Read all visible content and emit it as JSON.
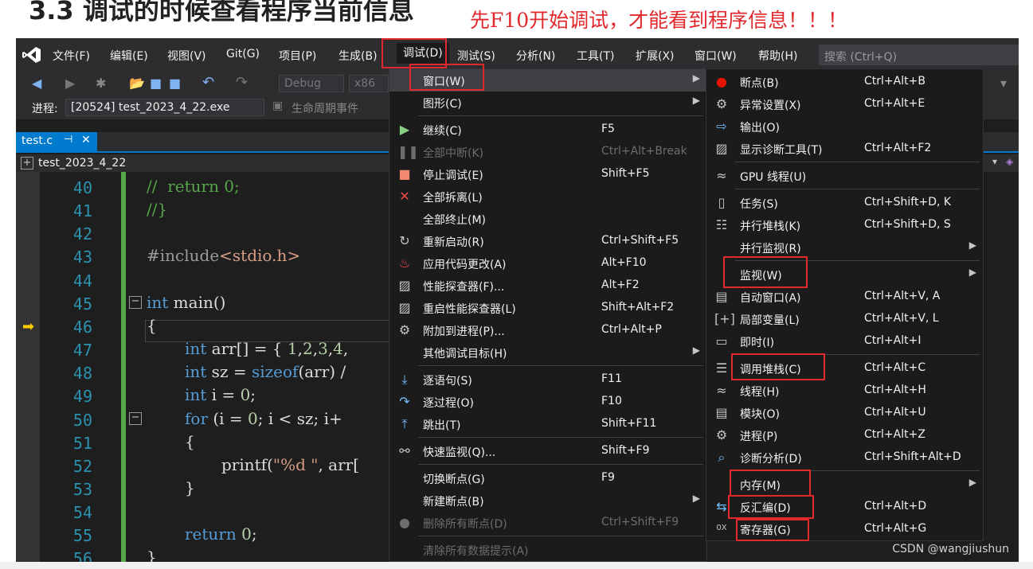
{
  "page": {
    "heading": "3.3 调试的时候查看程序当前信息",
    "annotation": "先F10开始调试，才能看到程序信息！！！",
    "watermark": "CSDN @wangjiushun"
  },
  "menubar": {
    "items": [
      "文件(F)",
      "编辑(E)",
      "视图(V)",
      "Git(G)",
      "项目(P)",
      "生成(B)",
      "调试(D)",
      "测试(S)",
      "分析(N)",
      "工具(T)",
      "扩展(X)",
      "窗口(W)",
      "帮助(H)"
    ],
    "search_placeholder": "搜索 (Ctrl+Q)"
  },
  "toolbar": {
    "config": "Debug",
    "platform": "x86",
    "process_label": "进程:",
    "process_value": "[20524] test_2023_4_22.exe",
    "lifecycle": "生命周期事件"
  },
  "tab": {
    "label": "test.c"
  },
  "nav": {
    "project": "test_2023_4_22"
  },
  "editor": {
    "line_numbers": [
      "40",
      "41",
      "42",
      "43",
      "44",
      "45",
      "46",
      "47",
      "48",
      "49",
      "50",
      "51",
      "52",
      "53",
      "54",
      "55",
      "56"
    ]
  },
  "debug_menu": {
    "items": [
      {
        "label": "窗口(W)",
        "shortcut": "",
        "sub": true
      },
      {
        "label": "图形(C)",
        "shortcut": "",
        "sub": true
      },
      {
        "label": "继续(C)",
        "shortcut": "F5"
      },
      {
        "label": "全部中断(K)",
        "shortcut": "Ctrl+Alt+Break"
      },
      {
        "label": "停止调试(E)",
        "shortcut": "Shift+F5"
      },
      {
        "label": "全部拆离(L)",
        "shortcut": ""
      },
      {
        "label": "全部终止(M)",
        "shortcut": ""
      },
      {
        "label": "重新启动(R)",
        "shortcut": "Ctrl+Shift+F5"
      },
      {
        "label": "应用代码更改(A)",
        "shortcut": "Alt+F10"
      },
      {
        "label": "性能探查器(F)...",
        "shortcut": "Alt+F2"
      },
      {
        "label": "重启性能探查器(L)",
        "shortcut": "Shift+Alt+F2"
      },
      {
        "label": "附加到进程(P)...",
        "shortcut": "Ctrl+Alt+P"
      },
      {
        "label": "其他调试目标(H)",
        "shortcut": "",
        "sub": true
      },
      {
        "label": "逐语句(S)",
        "shortcut": "F11"
      },
      {
        "label": "逐过程(O)",
        "shortcut": "F10"
      },
      {
        "label": "跳出(T)",
        "shortcut": "Shift+F11"
      },
      {
        "label": "快速监视(Q)...",
        "shortcut": "Shift+F9"
      },
      {
        "label": "切换断点(G)",
        "shortcut": "F9"
      },
      {
        "label": "新建断点(B)",
        "shortcut": "",
        "sub": true
      },
      {
        "label": "删除所有断点(D)",
        "shortcut": "Ctrl+Shift+F9"
      },
      {
        "label": "清除所有数据提示(A)",
        "shortcut": ""
      }
    ]
  },
  "window_menu": {
    "items": [
      {
        "label": "断点(B)",
        "shortcut": "Ctrl+Alt+B"
      },
      {
        "label": "异常设置(X)",
        "shortcut": "Ctrl+Alt+E"
      },
      {
        "label": "输出(O)",
        "shortcut": ""
      },
      {
        "label": "显示诊断工具(T)",
        "shortcut": "Ctrl+Alt+F2"
      },
      {
        "label": "GPU 线程(U)",
        "shortcut": ""
      },
      {
        "label": "任务(S)",
        "shortcut": "Ctrl+Shift+D, K"
      },
      {
        "label": "并行堆栈(K)",
        "shortcut": "Ctrl+Shift+D, S"
      },
      {
        "label": "并行监视(R)",
        "shortcut": "",
        "sub": true
      },
      {
        "label": "监视(W)",
        "shortcut": "",
        "sub": true
      },
      {
        "label": "自动窗口(A)",
        "shortcut": "Ctrl+Alt+V, A"
      },
      {
        "label": "局部变量(L)",
        "shortcut": "Ctrl+Alt+V, L"
      },
      {
        "label": "即时(I)",
        "shortcut": "Ctrl+Alt+I"
      },
      {
        "label": "调用堆栈(C)",
        "shortcut": "Ctrl+Alt+C"
      },
      {
        "label": "线程(H)",
        "shortcut": "Ctrl+Alt+H"
      },
      {
        "label": "模块(O)",
        "shortcut": "Ctrl+Alt+U"
      },
      {
        "label": "进程(P)",
        "shortcut": "Ctrl+Alt+Z"
      },
      {
        "label": "诊断分析(D)",
        "shortcut": "Ctrl+Shift+Alt+D"
      },
      {
        "label": "内存(M)",
        "shortcut": "",
        "sub": true
      },
      {
        "label": "反汇编(D)",
        "shortcut": "Ctrl+Alt+D"
      },
      {
        "label": "寄存器(G)",
        "shortcut": "Ctrl+Alt+G"
      }
    ]
  },
  "icons": {
    "vs_logo": "visual-studio-logo-icon",
    "pin": "pin-icon",
    "close": "close-icon",
    "breakpoint_arrow": "current-line-arrow-icon",
    "colors": {
      "accent": "#007acc",
      "annotation_red": "#e0282d",
      "menu_bg": "#1b1b1c"
    }
  }
}
